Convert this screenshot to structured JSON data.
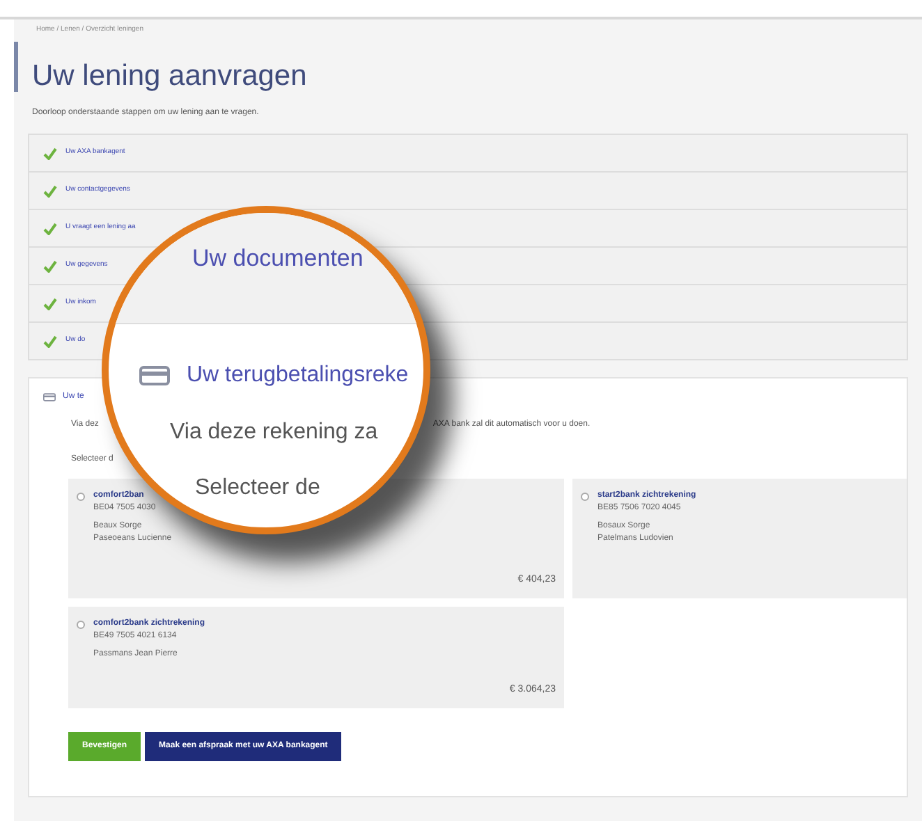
{
  "breadcrumb": "Home / Lenen / Overzicht leningen",
  "title": "Uw lening aanvragen",
  "subtitle": "Doorloop onderstaande stappen om uw lening aan te vragen.",
  "steps": [
    {
      "label": "Uw AXA bankagent",
      "done": true
    },
    {
      "label": "Uw contactgegevens",
      "done": true
    },
    {
      "label": "U vraagt een lening aa",
      "done": true
    },
    {
      "label": "Uw gegevens",
      "done": true
    },
    {
      "label": "Uw inkom",
      "done": true
    },
    {
      "label": "Uw do",
      "done": true
    }
  ],
  "current_step": {
    "title": "Uw te",
    "intro_start": "Via dez",
    "intro_end": "AXA bank zal dit automatisch voor u doen.",
    "select_label": "Selecteer d",
    "accounts": [
      {
        "name": "comfort2ban",
        "number": "BE04 7505 4030",
        "lines": [
          "Beaux Sorge",
          "Paseoeans Lucienne"
        ],
        "amount": "€ 404,23",
        "selected": false
      },
      {
        "name": "start2bank zichtrekening",
        "number": "BE85 7506 7020 4045",
        "lines": [
          "Bosaux Sorge",
          "Patelmans Ludovien"
        ],
        "selected": false
      },
      {
        "name": "comfort2bank zichtrekening",
        "number": "BE49 7505 4021 6134",
        "lines": [
          "Passmans Jean Pierre"
        ],
        "amount": "€ 3.064,23",
        "selected": false
      }
    ]
  },
  "buttons": [
    {
      "label": "Bevestigen",
      "kind": "primary"
    },
    {
      "label": "Maak een afspraak met uw AXA bankagent",
      "kind": "secondary"
    }
  ],
  "magnifier": [
    {
      "kind": "step",
      "text": "Uw documenten"
    },
    {
      "kind": "section",
      "text": "Uw terugbetalingsreke"
    },
    {
      "kind": "text",
      "text": "Via deze rekening za"
    },
    {
      "kind": "text",
      "text": "Selecteer de"
    }
  ]
}
